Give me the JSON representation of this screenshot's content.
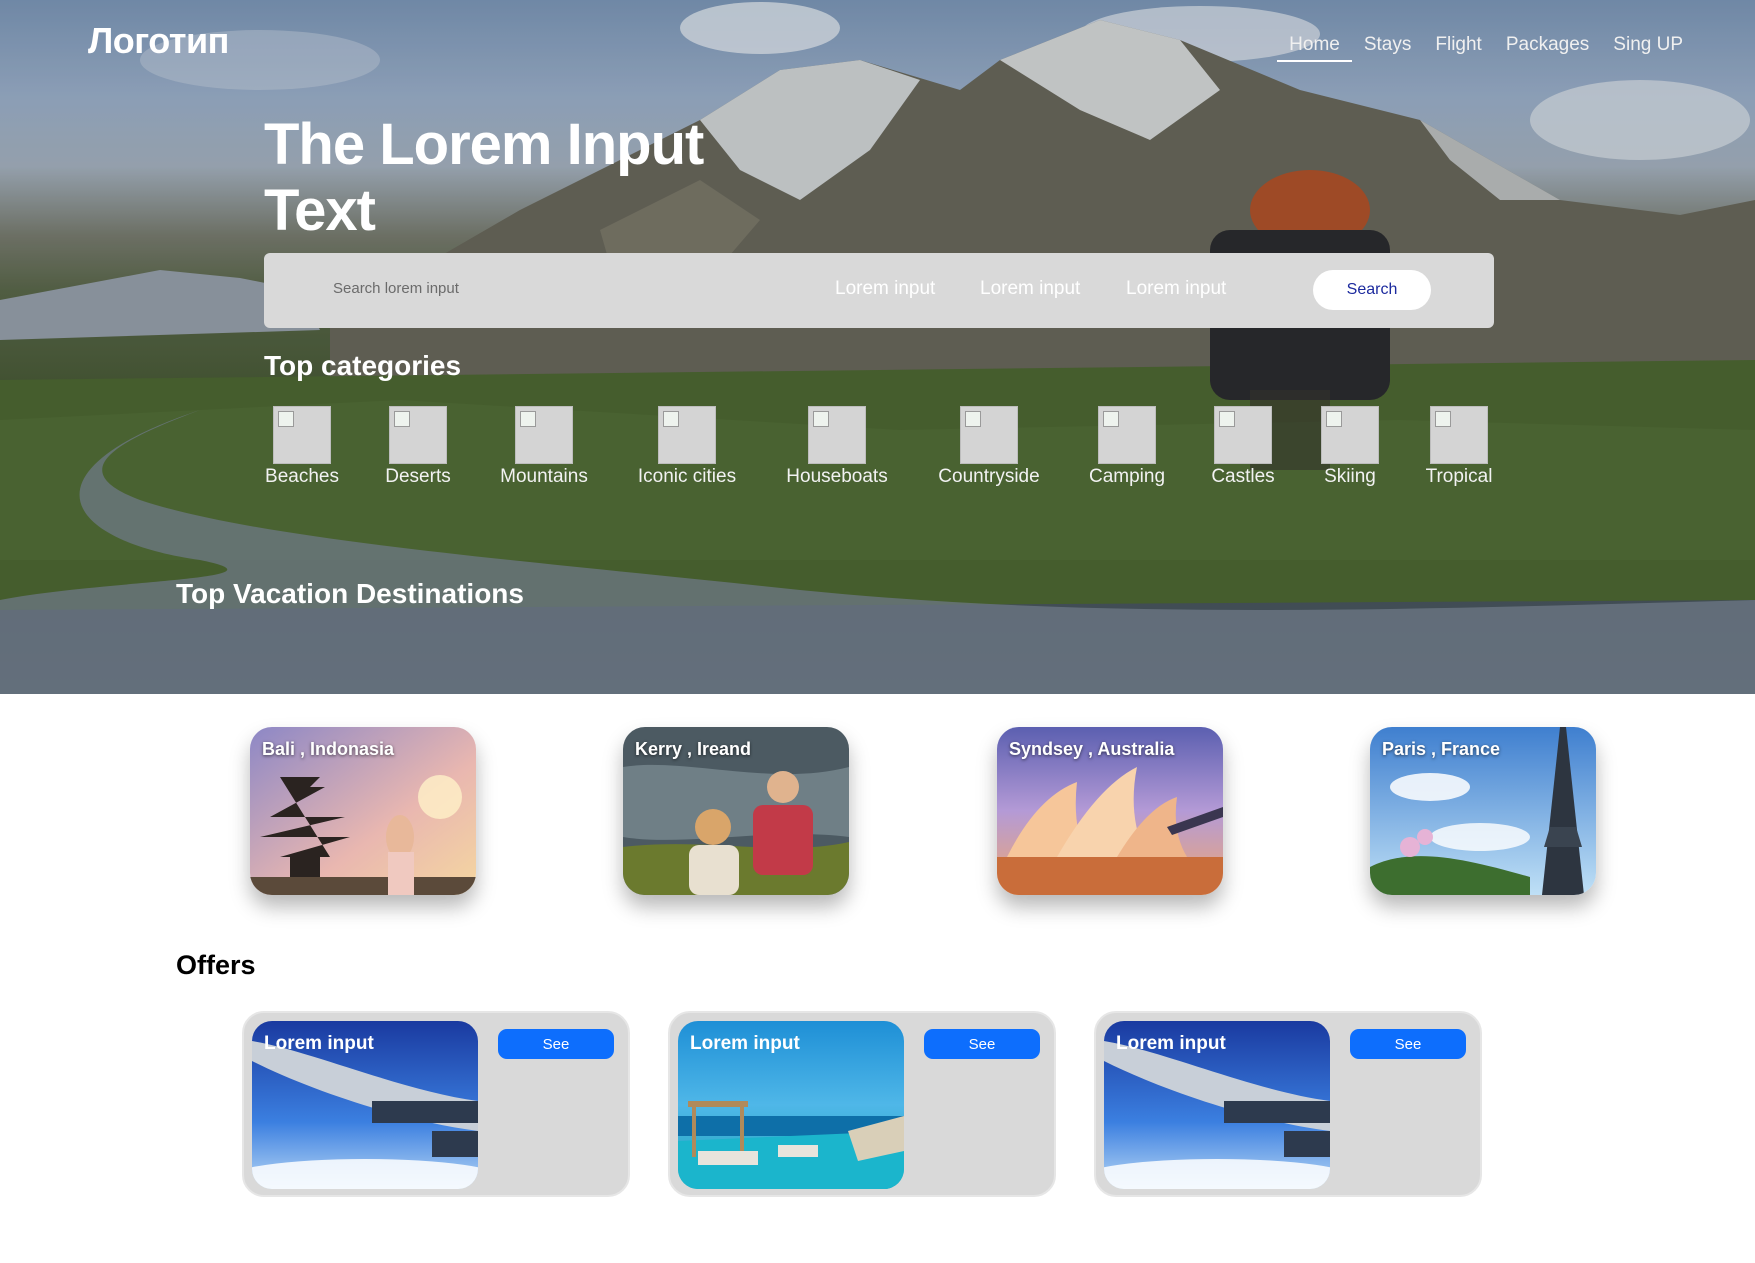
{
  "brand": {
    "logo": "Логотип"
  },
  "nav": {
    "items": [
      "Home",
      "Stays",
      "Flight",
      "Packages",
      "Sing UP"
    ],
    "active": "Home"
  },
  "hero": {
    "headline": "The Lorem Input Text",
    "search": {
      "placeholder": "Search lorem input",
      "options": [
        "Lorem input",
        "Lorem input",
        "Lorem input"
      ],
      "button": "Search"
    }
  },
  "categories": {
    "title": "Top categories",
    "items": [
      "Beaches",
      "Deserts",
      "Mountains",
      "Iconic cities",
      "Houseboats",
      "Countryside",
      "Camping",
      "Castles",
      "Skiing",
      "Tropical"
    ]
  },
  "destinations": {
    "title": "Top Vacation Destinations",
    "items": [
      "Bali , Indonasia",
      "Kerry , Ireand",
      "Syndsey , Australia",
      "Paris , France"
    ]
  },
  "offers": {
    "title": "Offers",
    "items": [
      {
        "caption": "Lorem input",
        "button": "See",
        "image": "airplane-wing"
      },
      {
        "caption": "Lorem input",
        "button": "See",
        "image": "pool-sea"
      },
      {
        "caption": "Lorem input",
        "button": "See",
        "image": "airplane-wing"
      }
    ]
  },
  "colors": {
    "accent": "#0d6efd",
    "search_bar": "#d9d9d9",
    "search_button_text": "#1c2a9e"
  }
}
